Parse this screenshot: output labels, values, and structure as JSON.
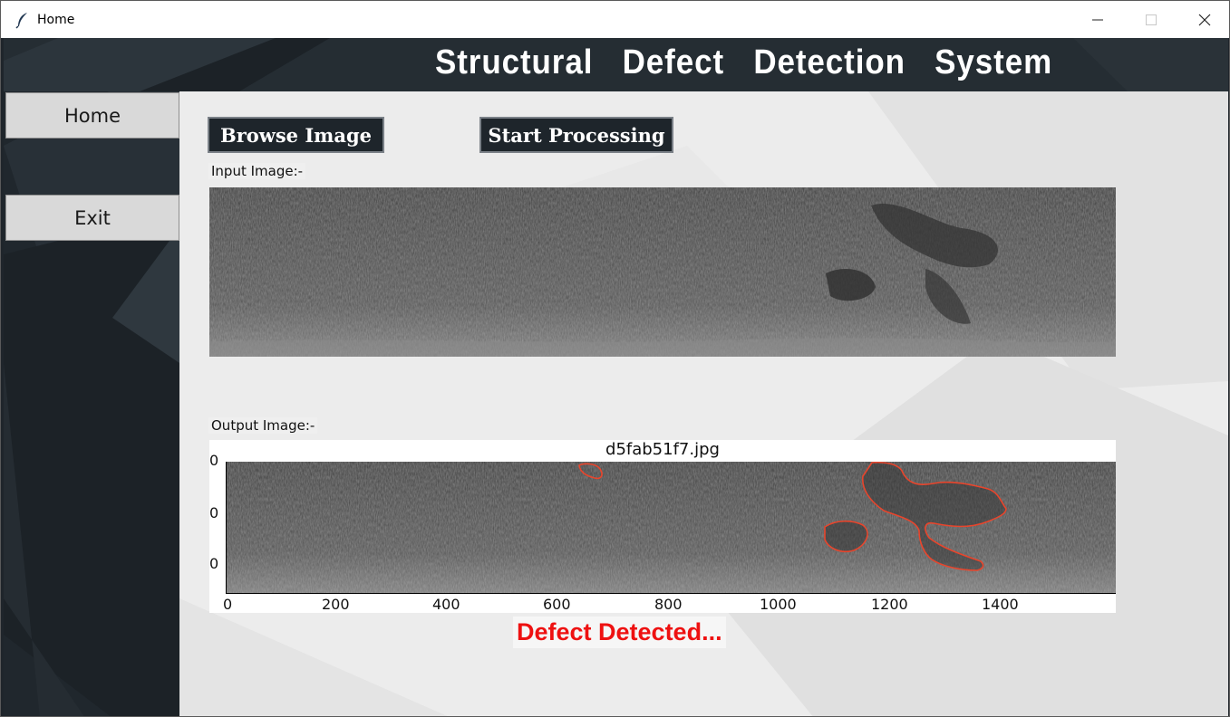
{
  "window": {
    "title": "Home",
    "icon": "feather-icon",
    "controls": [
      "minimize-icon",
      "maximize-icon",
      "close-icon"
    ]
  },
  "header": {
    "title": "Structural  Defect  Detection  System"
  },
  "sidebar": {
    "items": [
      {
        "label": "Home"
      },
      {
        "label": "Exit"
      }
    ]
  },
  "toolbar": {
    "browse_label": "Browse Image",
    "process_label": "Start Processing"
  },
  "input_section": {
    "label": "Input Image:-"
  },
  "output_section": {
    "label": "Output Image:-",
    "plot_title": "d5fab51f7.jpg",
    "x_ticks": [
      "0",
      "200",
      "400",
      "600",
      "800",
      "1000",
      "1200",
      "1400"
    ],
    "y_ticks": [
      "0",
      "0",
      "0"
    ]
  },
  "status": {
    "text": "Defect Detected...",
    "color": "#ee1111"
  },
  "colors": {
    "header_bg": "#252d33",
    "button_bg": "#1e252b",
    "contour": "#e8452c"
  }
}
